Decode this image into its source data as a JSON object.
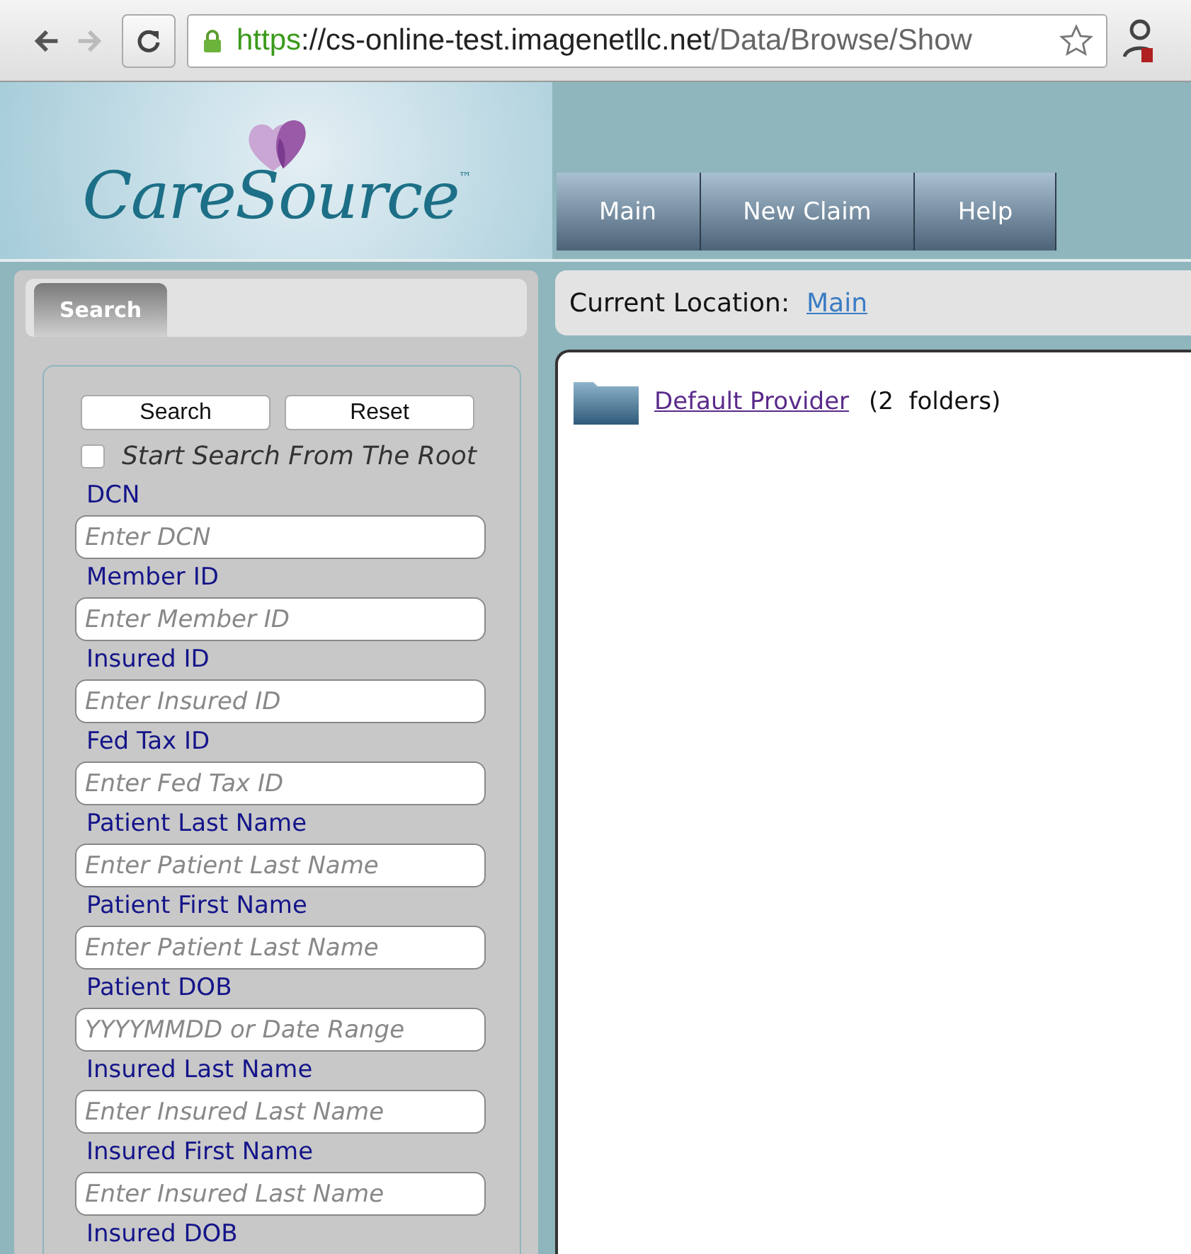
{
  "browser": {
    "url_scheme": "https",
    "url_host": "://cs-online-test.imagenetllc.net",
    "url_path": "/Data/Browse/Show"
  },
  "logo": {
    "name": "CareSource",
    "mark": "™"
  },
  "nav": [
    {
      "label": "Main"
    },
    {
      "label": "New Claim"
    },
    {
      "label": "Help"
    }
  ],
  "sidebar": {
    "tabs": [
      {
        "label": "Search",
        "selected": true
      }
    ],
    "buttons": [
      "Search",
      "Reset"
    ],
    "root_option": {
      "label": "Start Search From The Root",
      "checked": false
    },
    "fields": [
      {
        "label": "DCN",
        "placeholder": "Enter DCN"
      },
      {
        "label": "Member ID",
        "placeholder": "Enter Member ID"
      },
      {
        "label": "Insured ID",
        "placeholder": "Enter Insured ID"
      },
      {
        "label": "Fed Tax ID",
        "placeholder": "Enter Fed Tax ID"
      },
      {
        "label": "Patient Last Name",
        "placeholder": "Enter Patient Last Name"
      },
      {
        "label": "Patient First Name",
        "placeholder": "Enter Patient Last Name"
      },
      {
        "label": "Patient DOB",
        "placeholder": "YYYYMMDD or Date Range"
      },
      {
        "label": "Insured Last Name",
        "placeholder": "Enter Insured Last Name"
      },
      {
        "label": "Insured First Name",
        "placeholder": "Enter Insured Last Name"
      },
      {
        "label": "Insured DOB"
      }
    ]
  },
  "location": {
    "label": "Current Location:",
    "link": "Main"
  },
  "folders": [
    {
      "name": "Default Provider",
      "count": "(2  folders)"
    }
  ]
}
